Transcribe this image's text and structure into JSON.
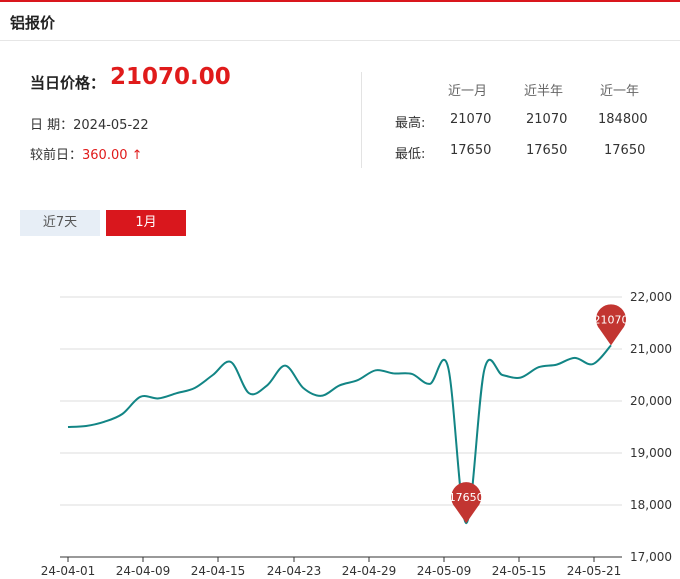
{
  "header": {
    "title": "铝报价"
  },
  "current": {
    "label": "当日价格：",
    "value": "21070.00",
    "date_label": "日 期：",
    "date": "2024-05-22",
    "change_label": "较前日：",
    "change": "360.00",
    "change_arrow": "↑"
  },
  "stats": {
    "columns": [
      "近一月",
      "近半年",
      "近一年"
    ],
    "rows": [
      {
        "label": "最高:",
        "values": [
          "21070",
          "21070",
          "184800"
        ]
      },
      {
        "label": "最低:",
        "values": [
          "17650",
          "17650",
          "17650"
        ]
      }
    ]
  },
  "tabs": [
    {
      "label": "近7天",
      "active": false
    },
    {
      "label": "1月",
      "active": true
    }
  ],
  "colors": {
    "accent": "#d9171d",
    "line": "#128585",
    "marker": "#c23531"
  },
  "chart_data": {
    "type": "line",
    "x_ticks": [
      "24-04-01",
      "24-04-09",
      "24-04-15",
      "24-04-23",
      "24-04-29",
      "24-05-09",
      "24-05-15",
      "24-05-21"
    ],
    "y_ticks": [
      "17,000",
      "18,000",
      "19,000",
      "20,000",
      "21,000",
      "22,000"
    ],
    "ylim": [
      17000,
      22000
    ],
    "grid": true,
    "series": [
      {
        "values": [
          19500,
          19520,
          19600,
          19750,
          20080,
          20050,
          20150,
          20250,
          20500,
          20750,
          20150,
          20300,
          20680,
          20250,
          20100,
          20300,
          20400,
          20590,
          20530,
          20520,
          20330,
          20650,
          17650,
          20600,
          20500,
          20450,
          20650,
          20700,
          20830,
          20710,
          21070
        ]
      }
    ],
    "markers": [
      {
        "label": "17650",
        "index": 22,
        "value": 17650
      },
      {
        "label": "21070",
        "index": 30,
        "value": 21070
      }
    ]
  }
}
